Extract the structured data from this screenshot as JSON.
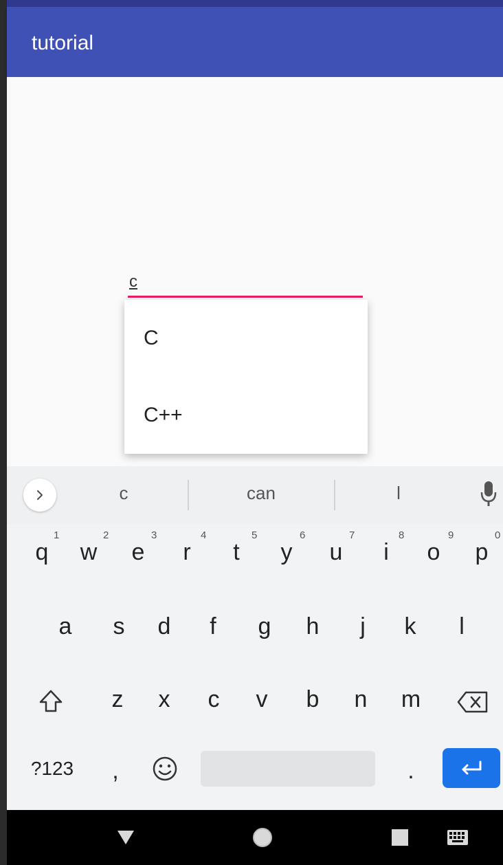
{
  "app_bar": {
    "title": "tutorial"
  },
  "input": {
    "value": "c"
  },
  "dropdown": {
    "items": [
      "C",
      "C++"
    ]
  },
  "suggestions": {
    "items": [
      "c",
      "can",
      "l"
    ]
  },
  "keyboard": {
    "row1": [
      "q",
      "w",
      "e",
      "r",
      "t",
      "y",
      "u",
      "i",
      "o",
      "p"
    ],
    "row1_hints": [
      "1",
      "2",
      "3",
      "4",
      "5",
      "6",
      "7",
      "8",
      "9",
      "0"
    ],
    "row2": [
      "a",
      "s",
      "d",
      "f",
      "g",
      "h",
      "j",
      "k",
      "l"
    ],
    "row3": [
      "z",
      "x",
      "c",
      "v",
      "b",
      "n",
      "m"
    ],
    "symbols_label": "?123",
    "comma": ",",
    "period": "."
  },
  "icons": {
    "expand": "chevron-right-icon",
    "mic": "mic-icon",
    "shift": "shift-icon",
    "backspace": "backspace-icon",
    "emoji": "emoji-icon",
    "enter": "enter-icon",
    "nav_back": "back-triangle-icon",
    "nav_home": "home-circle-icon",
    "nav_recents": "recents-square-icon",
    "nav_keyboard": "keyboard-icon"
  },
  "colors": {
    "app_bar": "#3f51b5",
    "accent_underline": "#e91e63",
    "enter_key": "#1a73e8"
  }
}
